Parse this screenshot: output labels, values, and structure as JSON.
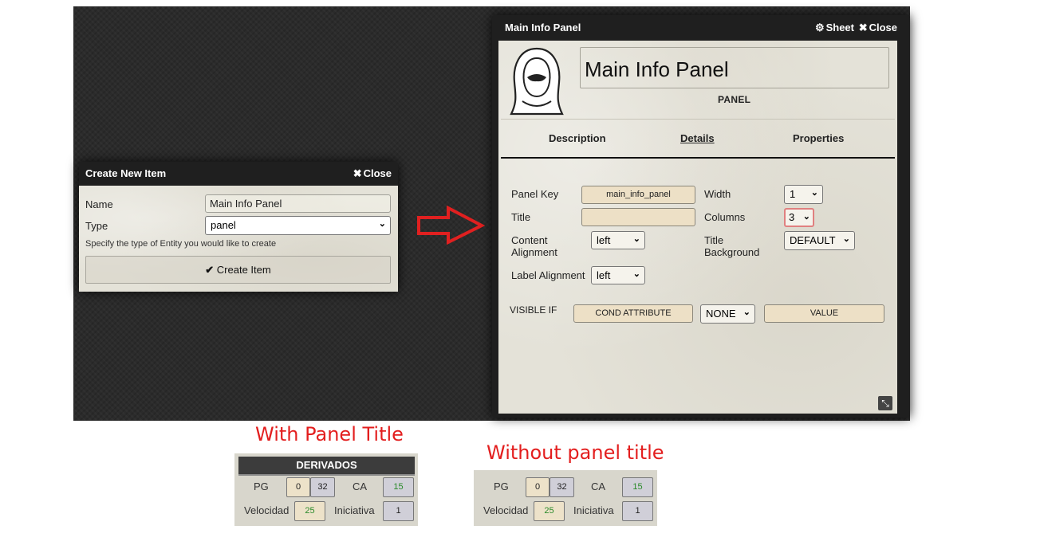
{
  "create_window": {
    "title": "Create New Item",
    "close_label": "Close",
    "name_label": "Name",
    "name_value": "Main Info Panel",
    "type_label": "Type",
    "type_value": "panel",
    "hint": "Specify the type of Entity you would like to create",
    "create_button": "Create Item"
  },
  "main_window": {
    "title": "Main Info Panel",
    "sheet_label": "Sheet",
    "close_label": "Close",
    "entity_name": "Main Info Panel",
    "entity_type": "PANEL",
    "tabs": [
      {
        "label": "Description",
        "active": false
      },
      {
        "label": "Details",
        "active": true
      },
      {
        "label": "Properties",
        "active": false
      }
    ],
    "form": {
      "panel_key_label": "Panel Key",
      "panel_key_value": "main_info_panel",
      "title_label": "Title",
      "title_value": "",
      "content_alignment_label_1": "Content",
      "content_alignment_label_2": "Alignment",
      "content_alignment_value": "left",
      "label_alignment_label": "Label Alignment",
      "label_alignment_value": "left",
      "width_label": "Width",
      "width_value": "1",
      "columns_label": "Columns",
      "columns_value": "3",
      "title_bg_label_1": "Title",
      "title_bg_label_2": "Background",
      "title_bg_value": "DEFAULT",
      "visible_if_label": "VISIBLE IF",
      "cond_attribute_placeholder": "COND ATTRIBUTE",
      "operator_value": "NONE",
      "value_placeholder": "VALUE"
    }
  },
  "captions": {
    "with_title": "With Panel Title",
    "without_title": "Without panel title"
  },
  "example_with_title": {
    "header": "DERIVADOS",
    "pg_label": "PG",
    "pg_current": "0",
    "pg_max": "32",
    "ca_label": "CA",
    "ca_value": "15",
    "velocidad_label": "Velocidad",
    "velocidad_value": "25",
    "iniciativa_label": "Iniciativa",
    "iniciativa_value": "1"
  },
  "example_without_title": {
    "pg_label": "PG",
    "pg_current": "0",
    "pg_max": "32",
    "ca_label": "CA",
    "ca_value": "15",
    "velocidad_label": "Velocidad",
    "velocidad_value": "25",
    "iniciativa_label": "Iniciativa",
    "iniciativa_value": "1"
  },
  "colors": {
    "caption_red": "#e31e1e",
    "arrow_red": "#e02020",
    "field_tan": "#ede0c6",
    "green_text": "#2a8a2a"
  },
  "icons": {
    "close": "close-icon",
    "sheet": "gear-icon",
    "create": "check-icon",
    "arrow": "right-arrow-icon",
    "resize": "resize-icon"
  }
}
